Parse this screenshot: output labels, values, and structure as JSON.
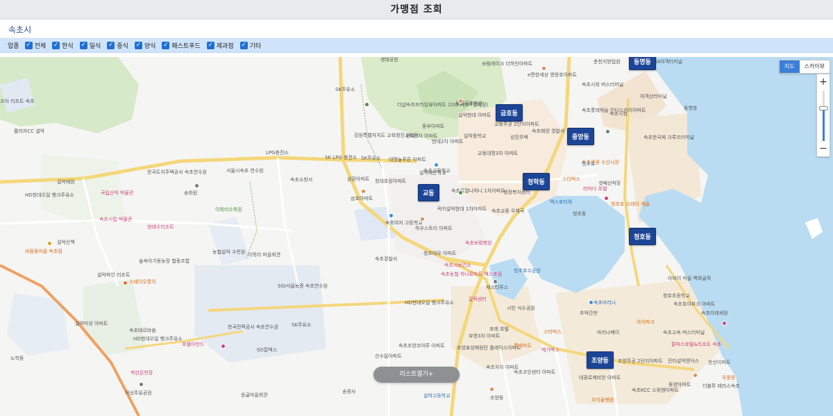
{
  "page": {
    "title": "가맹점 조회",
    "city": "속초시"
  },
  "filter": {
    "label": "업종",
    "options": [
      {
        "label": "전체",
        "checked": true
      },
      {
        "label": "한식",
        "checked": true
      },
      {
        "label": "일식",
        "checked": true
      },
      {
        "label": "중식",
        "checked": true
      },
      {
        "label": "양식",
        "checked": true
      },
      {
        "label": "패스트푸드",
        "checked": true
      },
      {
        "label": "제과점",
        "checked": true
      },
      {
        "label": "기타",
        "checked": true
      }
    ]
  },
  "map": {
    "type_buttons": {
      "map": "지도",
      "skyview": "스카이뷰"
    },
    "zoom": {
      "in": "+",
      "out": "−",
      "level": 0.35
    },
    "list_button": "리스트열기+",
    "dong_markers": [
      "동명동",
      "금호동",
      "중앙동",
      "청학동",
      "교동",
      "청호동",
      "조양동"
    ],
    "labels": [
      "생태공원",
      "SK주유소",
      "보람레이크 더하인아파트",
      "춘천지방법원",
      "제4여객터미널",
      "속초시외 버스터미널",
      "여객선터미널",
      "코아 리조트 속초",
      "더샵속초프라임뷰아파트 (2027년07월예정)",
      "로얄금호맨션",
      "e편한세상 영랑호아파트",
      "플라자CC 설악",
      "설악현대 아파트",
      "동부아파트",
      "교동주공 2단지아파트",
      "속초롯데캐슬 인디스카이아파트",
      "속초시청",
      "현대3차 아파트",
      "현대2차 아파트",
      "설악중학교",
      "성진주택",
      "속초해양 경찰서",
      "동명항",
      "LPG충전소",
      "SK LPG 충전소",
      "SK주유소",
      "강원특별자치도 교육청진교육원",
      "대명늘푸른 아파트",
      "교동대명3차 아파트",
      "속초한국제 크루즈터미널",
      "설악예문학교",
      "한국도지주택공사 속초연수원",
      "서울시속초 연수원",
      "속초소방서",
      "숭화원",
      "청대호원아파트",
      "삼환아파트",
      "속초고등학교",
      "청초호",
      "속초관광 수산시장",
      "국립산악 박물관",
      "설악예원",
      "속초로얄나하니 1차아파트",
      "행정복지센터",
      "스타벅스",
      "갯배선착장",
      "라마다 호텔",
      "HD현대오일 뱅크주유소",
      "이목리수목원",
      "삼호아파트",
      "속초교동 우체국",
      "럭키설악현대 1차아파트",
      "속초시립 박물관",
      "현대수리조트",
      "속초여자 고등학교",
      "하우스토리 아파트",
      "엑스포타워",
      "청초동",
      "설악산책",
      "농협설악 수련원",
      "속초보람병원",
      "청초호 스테이 캐슬",
      "바람꽃마을 속초점",
      "숲속아기동농장 협동조합",
      "이목리 마을회관",
      "청초대우 아파트",
      "속초시보건소",
      "속초경찰서",
      "청초호수공원",
      "설악파인 리조트",
      "스테이오롯이",
      "SGI서울보증 속초연수원",
      "속초농협 하나로마트 엑스포점",
      "제스티투스",
      "아바이 마을 벽화골목",
      "청호초등학교",
      "속초호이파크 아파트",
      "HD현대오일 뱅크주유소",
      "갈릭센터",
      "시민 식수공원",
      "속초마리나",
      "추억간판",
      "설악미성 아파트",
      "속초라테세원",
      "한국전력공사 속초연수원",
      "SK주유소",
      "포레 호텔",
      "부영3차 아파트",
      "스타벅스",
      "아이파크",
      "마리나베이",
      "속초고속 버스터미널",
      "속초테르바움",
      "HD현대오일 뱅크주유소",
      "호텔아란드",
      "GS칼텍스",
      "속초조양코아루 아파트",
      "조양효성해링턴 플레이스아파트",
      "롯데마트",
      "메가박스",
      "팔파스호텔&리조트 속초",
      "노학동",
      "산수밀아파트",
      "속초자이 아파트",
      "속초코인센터 아파트",
      "조양주공 2단지아파트",
      "진타설악엔닥스",
      "한산이파트",
      "속초KCC 스위첸아파트",
      "대광로제비앙 아파트",
      "동양아파트",
      "더블루 테라스속초",
      "송광사",
      "응골마을회관",
      "우리들병원",
      "조양동",
      "우동탕",
      "설악고등학교",
      "척산온천장",
      "적선주유공원"
    ]
  },
  "colors": {
    "title_bar": "#e9eaec",
    "filter_bar": "#cfe4fa",
    "checkbox": "#1f6fd6",
    "dong_marker": "#1d4597",
    "sea": "#b9dcf2",
    "map_toggle_on": "#3b7fd9",
    "list_button": "#8f9091"
  }
}
